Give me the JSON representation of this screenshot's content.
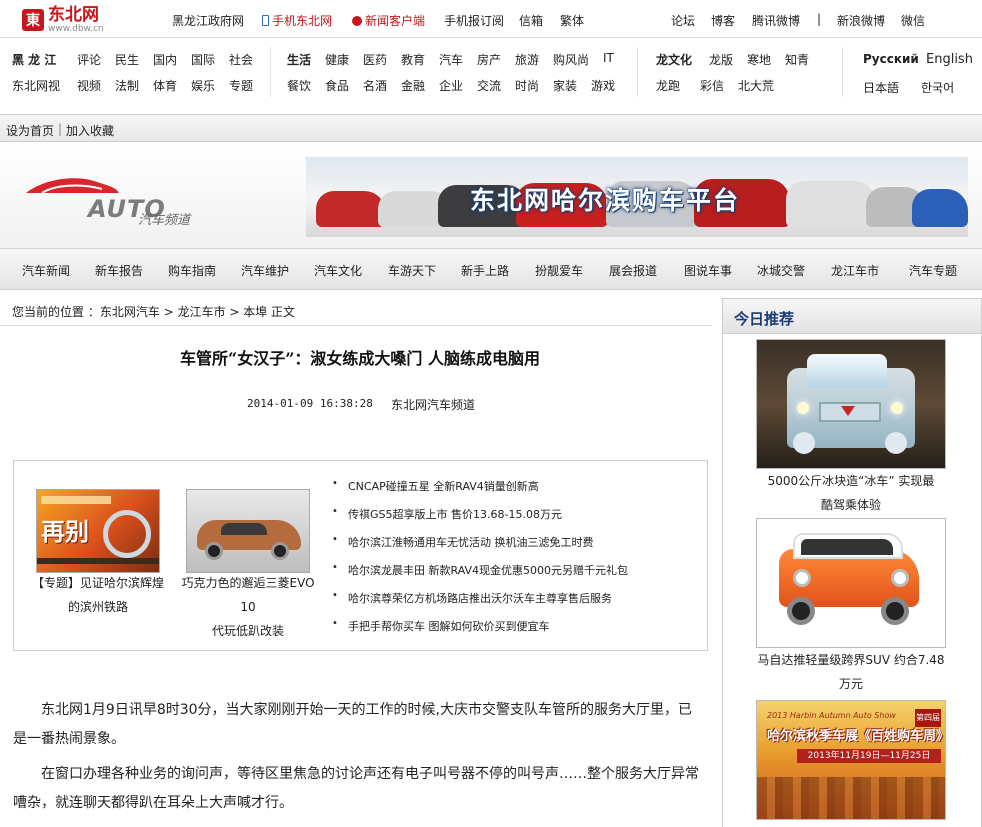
{
  "header": {
    "logo_cn": "东北网",
    "logo_url": "www.dbw.cn",
    "links": [
      "黑龙江政府网",
      "手机东北网",
      "新闻客户端",
      "手机报订阅",
      "信箱",
      "繁体"
    ],
    "right_links": [
      "论坛",
      "博客",
      "腾讯微博",
      "|",
      "新浪微博",
      "微信"
    ]
  },
  "catnav": {
    "group1_row1": [
      "黑 龙 江",
      "评论",
      "民生",
      "国内",
      "国际",
      "社会"
    ],
    "group1_row2": [
      "东北网视",
      "视频",
      "法制",
      "体育",
      "娱乐",
      "专题"
    ],
    "group2_row1": [
      "生活",
      "健康",
      "医药",
      "教育",
      "汽车",
      "房产",
      "旅游",
      "购风尚",
      "IT"
    ],
    "group2_row2": [
      "餐饮",
      "食品",
      "名酒",
      "金融",
      "企业",
      "交流",
      "时尚",
      "家装",
      "游戏"
    ],
    "group3_row1": [
      "龙文化",
      "龙版",
      "寒地",
      "知青"
    ],
    "group3_row2": [
      "龙跑",
      "彩信",
      "北大荒"
    ],
    "lang_row1": [
      "Русский",
      "English"
    ],
    "lang_row2": [
      "日本語",
      "한국어"
    ]
  },
  "favbar": {
    "home": "设为首页",
    "sep": "|",
    "fav": "加入收藏"
  },
  "banner": {
    "auto_word": "AUTO",
    "auto_sub": "汽车频道",
    "ad_title": "东北网哈尔滨购车平台"
  },
  "channav": [
    "汽车新闻",
    "新车报告",
    "购车指南",
    "汽车维护",
    "汽车文化",
    "车游天下",
    "新手上路",
    "扮靓爱车",
    "展会报道",
    "图说车事",
    "冰城交警",
    "龙江车市",
    "汽车专题"
  ],
  "breadcrumb": "您当前的位置 ：东北网汽车 > 龙江车市 > 本埠 正文",
  "article": {
    "title": "车管所“女汉子”：淑女练成大嗓门 人脑练成电脑用",
    "datetime": "2014-01-09 16:38:28",
    "source": "东北网汽车频道",
    "paragraphs": [
      "东北网1月9日讯早8时30分，当大家刚刚开始一天的工作的时候,大庆市交警支队车管所的服务大厅里，已是一番热闹景象。",
      "在窗口办理各种业务的询问声，等待区里焦急的讨论声还有电子叫号器不停的叫号声……整个服务大厅异常嘈杂，就连聊天都得趴在耳朵上大声喊才行。"
    ]
  },
  "related": {
    "thumbs": [
      {
        "img_text": "再别",
        "caption_l1": "【专题】见证哈尔滨辉煌",
        "caption_l2": "的滨州铁路"
      },
      {
        "caption_l1": "巧克力色的邂逅三菱EVO 10",
        "caption_l2": "代玩低趴改装"
      }
    ],
    "list": [
      "CNCAP碰撞五星 全新RAV4销量创新高",
      "传祺GS5超享版上市 售价13.68-15.08万元",
      "哈尔滨江淮畅通用车无忧活动 换机油三滤免工时费",
      "哈尔滨龙晨丰田 新款RAV4现金优惠5000元另赠千元礼包",
      "哈尔滨尊荣亿方机场路店推出沃尔沃车主尊享售后服务",
      "手把手帮你买车 图解如何砍价买到便宜车"
    ]
  },
  "sidebar": {
    "title": "今日推荐",
    "items": [
      {
        "caption_l1": "5000公斤冰块造“冰车” 实现最",
        "caption_l2": "酷驾乘体验"
      },
      {
        "caption_l1": "马自达推轻量级跨界SUV 约合7.48",
        "caption_l2": "万元"
      },
      {
        "img_top": "2013 Harbin Autumn Auto Show",
        "img_main": "哈尔滨秋季车展《百姓购车周》",
        "img_date": "2013年11月19日—11月25日",
        "img_badge": "第四届"
      }
    ]
  },
  "colors": {
    "brand_red": "#c8161d",
    "link_blue": "#1b3d75"
  }
}
